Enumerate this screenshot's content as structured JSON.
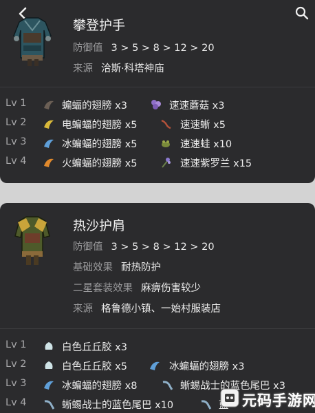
{
  "card1": {
    "title": "攀登护手",
    "defense_label": "防御值",
    "defense_value": "3 > 5 > 8 > 12 > 20",
    "source_label": "来源",
    "source_value": "洽斯·科塔神庙",
    "levels": [
      {
        "lv": "Lv 1",
        "m1": "蝙蝠的翅膀 x3",
        "m2": "速速蘑菇 x3"
      },
      {
        "lv": "Lv 2",
        "m1": "电蝙蝠的翅膀 x5",
        "m2": "速速蜥 x5"
      },
      {
        "lv": "Lv 3",
        "m1": "冰蝙蝠的翅膀 x5",
        "m2": "速速蛙 x10"
      },
      {
        "lv": "Lv 4",
        "m1": "火蝙蝠的翅膀 x5",
        "m2": "速速紫罗兰 x15"
      }
    ]
  },
  "card2": {
    "title": "热沙护肩",
    "defense_label": "防御值",
    "defense_value": "3 > 5 > 8 > 12 > 20",
    "effect_label": "基础效果",
    "effect_value": "耐热防护",
    "set_label": "二星套装效果",
    "set_value": "麻痹伤害较少",
    "source_label": "来源",
    "source_value": "格鲁德小镇、一始村服装店",
    "levels": [
      {
        "lv": "Lv 1",
        "m1": "白色丘丘胶 x3",
        "m2": ""
      },
      {
        "lv": "Lv 2",
        "m1": "白色丘丘胶 x5",
        "m2": "冰蝙蝠的翅膀 x3"
      },
      {
        "lv": "Lv 3",
        "m1": "冰蝙蝠的翅膀 x8",
        "m2": "蜥蜴战士的蓝色尾巴 x3"
      },
      {
        "lv": "Lv 4",
        "m1": "蜥蜴战士的蓝色尾巴 x10",
        "m2": "蓝"
      }
    ]
  },
  "watermark": "元码手游网",
  "colors": {
    "card_bg": "#2b2b2d",
    "page_bg": "#d3d3d3",
    "label": "#9b9b9d",
    "text": "#ececec"
  },
  "icons": [
    "back-arrow-icon",
    "search-icon",
    "bat-wing-icon",
    "mushroom-icon",
    "lizard-icon",
    "frog-icon",
    "violet-icon",
    "chuchu-jelly-icon",
    "lizalfos-tail-icon"
  ]
}
